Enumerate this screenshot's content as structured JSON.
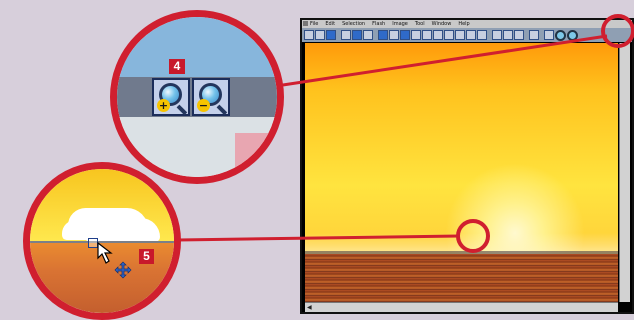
{
  "menu_items": [
    "File",
    "Edit",
    "Selection",
    "Flash",
    "Image",
    "Tool",
    "Window",
    "Help"
  ],
  "callout_4": {
    "label": "4",
    "zoom_in_sign": "+",
    "zoom_out_sign": "−"
  },
  "callout_5": {
    "label": "5"
  },
  "icons": [
    "zoom-in-icon",
    "zoom-out-icon",
    "arrow-cursor-icon",
    "move-cursor-icon"
  ],
  "colors": {
    "callout_red": "#d01f2f",
    "badge_red": "#c8192b",
    "background": "#d7cfdb"
  }
}
